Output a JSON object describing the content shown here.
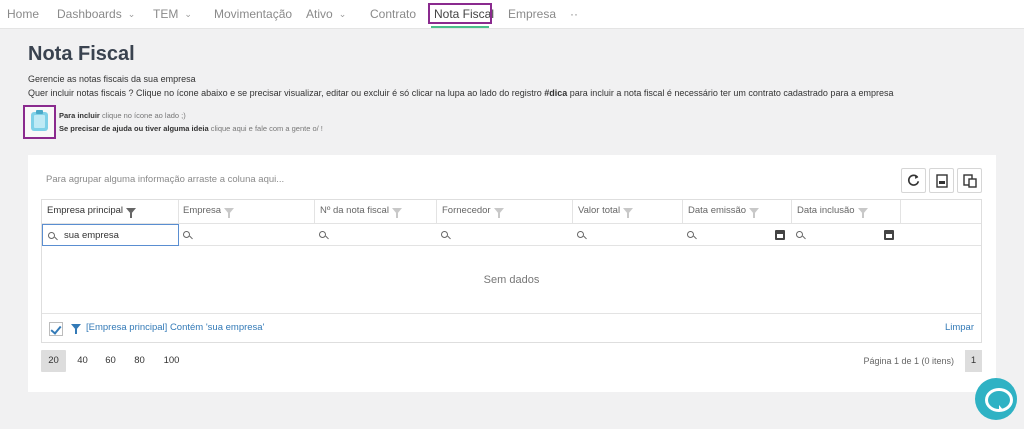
{
  "nav": {
    "items": [
      {
        "label": "Home",
        "dropdown": false
      },
      {
        "label": "Dashboards",
        "dropdown": true
      },
      {
        "label": "TEM",
        "dropdown": true
      },
      {
        "label": "Movimentação",
        "dropdown": false
      },
      {
        "label": "Ativo",
        "dropdown": true
      },
      {
        "label": "Contrato",
        "dropdown": false
      },
      {
        "label": "Nota Fiscal",
        "dropdown": false,
        "active": true
      },
      {
        "label": "Empresa",
        "dropdown": false
      },
      {
        "label": "··",
        "dropdown": false
      }
    ],
    "active_color": "#8a2a8e",
    "underline_color": "#4bbf8a"
  },
  "page": {
    "title": "Nota Fiscal",
    "subtitle": "Gerencie as notas fiscais da sua empresa",
    "description_pre": "Quer incluir notas fiscais ? Clique no ícone abaixo e se precisar visualizar, editar ou excluir é só clicar na lupa ao lado do registro ",
    "description_tag": "#dica",
    "description_post": " para incluir a nota fiscal é necessário ter um contrato cadastrado para a empresa"
  },
  "help": {
    "icon": "clipboard-icon",
    "line1_bold": "Para incluir",
    "line1_rest": " clique no ícone ao lado ;)",
    "line2_bold": "Se precisar de ajuda ou tiver alguma ideia",
    "line2_rest": " clique aqui e fale com a gente o/ !"
  },
  "grid": {
    "group_hint": "Para agrupar alguma informação arraste a coluna aqui...",
    "toolbar": [
      "refresh-icon",
      "pdf-export-icon",
      "excel-export-icon"
    ],
    "columns": [
      {
        "label": "Empresa principal"
      },
      {
        "label": "Empresa"
      },
      {
        "label": "Nº da nota fiscal"
      },
      {
        "label": "Fornecedor"
      },
      {
        "label": "Valor total"
      },
      {
        "label": "Data emissão"
      },
      {
        "label": "Data inclusão"
      }
    ],
    "filter_value": "sua empresa",
    "empty_text": "Sem dados",
    "filter_summary": "[Empresa principal] Contém 'sua empresa'",
    "clear_label": "Limpar"
  },
  "pager": {
    "sizes": [
      "20",
      "40",
      "60",
      "80",
      "100"
    ],
    "selected_size": "20",
    "info": "Página 1 de 1 (0 itens)",
    "current_page": "1"
  },
  "colors": {
    "accent": "#337ab7",
    "chat": "#2fb2c4"
  }
}
